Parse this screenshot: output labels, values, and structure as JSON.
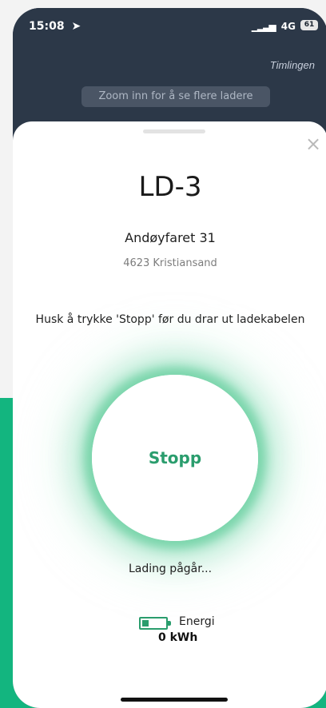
{
  "status_bar": {
    "time": "15:08",
    "network": "4G",
    "battery": "61"
  },
  "map": {
    "place_label": "Timlingen",
    "zoom_hint": "Zoom inn for å se flere ladere"
  },
  "charger": {
    "name": "LD-3",
    "address_line1": "Andøyfaret 31",
    "address_line2": "4623 Kristiansand"
  },
  "hint": "Husk å trykke 'Stopp' før du drar ut ladekabelen",
  "stop_button": {
    "label": "Stopp"
  },
  "charging_status": "Lading pågår...",
  "energy": {
    "label": "Energi",
    "value": "0 kWh"
  },
  "colors": {
    "accent": "#2a9d6d",
    "background_band": "#13b57f",
    "map": "#2c3848"
  },
  "icons": [
    "location-arrow-icon",
    "signal-icon",
    "battery-icon",
    "close-icon",
    "battery-energy-icon"
  ]
}
